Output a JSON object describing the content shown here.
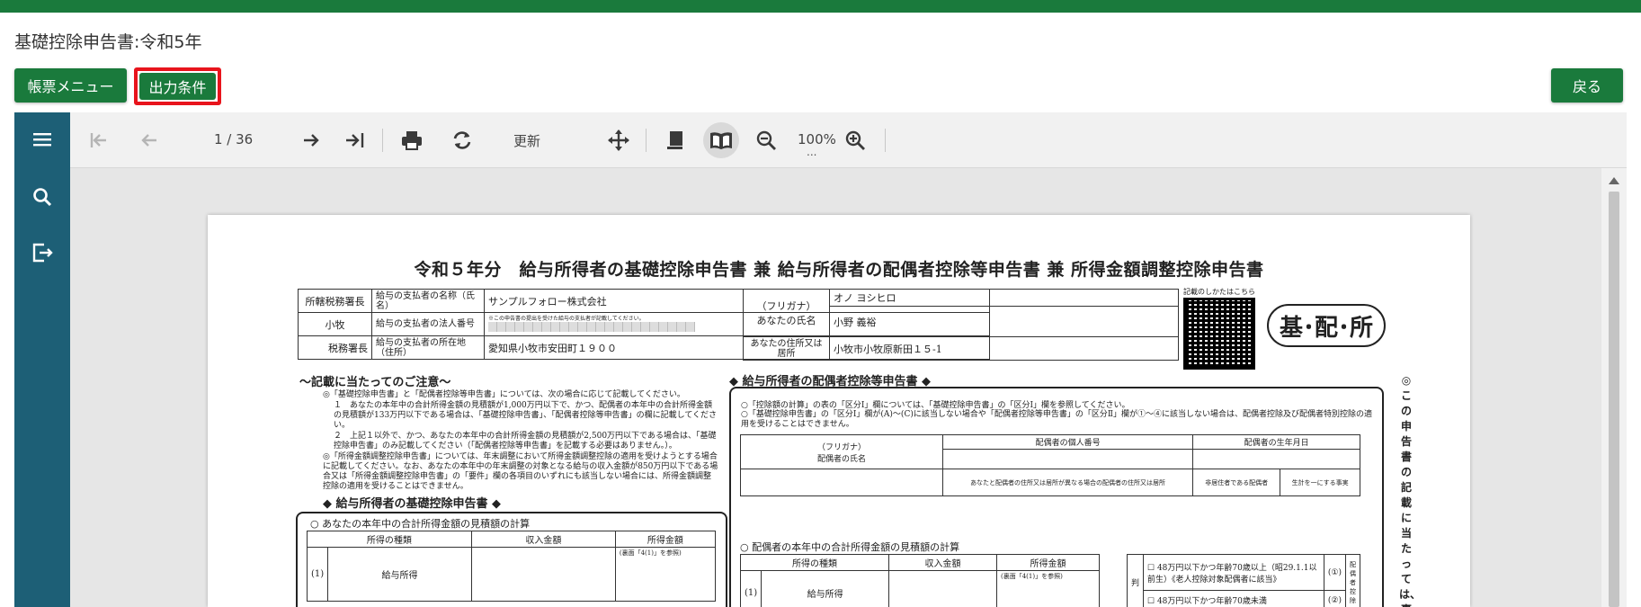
{
  "page": {
    "title": "基礎控除申告書:令和5年"
  },
  "buttons": {
    "menu": "帳票メニュー",
    "condition": "出力条件",
    "back": "戻る"
  },
  "colors": {
    "brand": "#1a7a3c",
    "sidebar": "#1d5f76",
    "highlight": "#e8141c"
  },
  "toolbar": {
    "page_indicator": "1 / 36",
    "refresh": "更新",
    "zoom": "100%",
    "zoom_more": "..."
  },
  "sidebar": {
    "icons": [
      "menu-icon",
      "search-icon",
      "export-icon"
    ]
  },
  "document": {
    "title": "令和５年分　給与所得者の基礎控除申告書 兼 給与所得者の配偶者控除等申告書 兼 所得金額調整控除申告書",
    "tax_office_label": "所轄税務署長",
    "tax_office": "小牧",
    "tax_office_suffix": "税務署長",
    "payer_name_label": "給与の支払者の名称（氏名）",
    "payer_name": "サンプルフォロー株式会社",
    "payer_number_label": "給与の支払者の法人番号",
    "payer_number_note": "※この申告書の提出を受けた給与の支払者が記載してください。",
    "payer_address_label": "給与の支払者の所在地（住所）",
    "payer_address": "愛知県小牧市安田町１９００",
    "furigana_label": "（フリガナ）",
    "name_label": "あなたの氏名",
    "furigana": "オノ ヨシヒロ",
    "name": "小野 義裕",
    "address_label": "あなたの住所又は居所",
    "address": "小牧市小牧原新田１５-1",
    "qr_caption": "記載のしかたはこちら",
    "logo": "基･配･所",
    "notes_title": "～記載に当たってのご注意～",
    "notes": [
      "◎「基礎控除申告書」と「配偶者控除等申告書」については、次の場合に応じて記載してください。",
      "１　あなたの本年中の合計所得金額の見積額が1,000万円以下で、かつ、配偶者の本年中の合計所得金額の見積額が133万円以下である場合は、「基礎控除申告書」、「配偶者控除等申告書」の欄に記載してください。",
      "２　上記１以外で、かつ、あなたの本年中の合計所得金額の見積額が2,500万円以下である場合は、「基礎控除申告書」のみ記載してください（「配偶者控除等申告書」を記載する必要はありません。）。",
      "◎「所得金額調整控除申告書」については、年末調整において所得金額調整控除の適用を受けようとする場合に記載してください。なお、あなたの本年中の年末調整の対象となる給与の収入金額が850万円以下である場合又は「所得金額調整控除申告書」の「要件」欄の各項目のいずれにも該当しない場合には、所得金額調整控除の適用を受けることはできません。"
    ],
    "basic_section": "◆ 給与所得者の基礎控除申告書 ◆",
    "basic_sub": "○ あなたの本年中の合計所得金額の見積額の計算",
    "spouse_section": "◆ 給与所得者の配偶者控除等申告書 ◆",
    "spouse_note1": "○「控除額の計算」の表の「区分Ⅰ」欄については、「基礎控除申告書」の「区分Ⅰ」欄を参照してください。",
    "spouse_note2": "○「基礎控除申告書」の「区分Ⅰ」欄が(A)～(C)に該当しない場合や「配偶者控除等申告書」の「区分Ⅱ」欄が①～④に該当しない場合は、配偶者控除及び配偶者特別控除の適用を受けることはできません。",
    "spouse_furigana": "（フリガナ）",
    "spouse_name_label": "配偶者の氏名",
    "spouse_number_label": "配偶者の個人番号",
    "spouse_birth_label": "配偶者の生年月日",
    "spouse_addr_diff": "あなたと配偶者の住所又は居所が異なる場合の配偶者の住所又は居所",
    "nonresident_label": "非居住者である配偶者",
    "living_label": "生計を一にする事実",
    "spouse_sub": "○ 配偶者の本年中の合計所得金額の見積額の計算",
    "income_cols": [
      "所得の種類",
      "収入金額",
      "所得金額"
    ],
    "income_row": [
      "(1)",
      "給与所得"
    ],
    "income_ref": "(裏面「4(1)」を参照)",
    "judge_label": "判",
    "judge1": "48万円以下かつ年齢70歳以上（昭29.1.1以前生）《老人控除対象配偶者に該当》",
    "judge1_mark": "(①)",
    "judge2": "48万円以下かつ年齢70歳未満",
    "judge2_mark": "(②)",
    "judge_side": "配偶者控除",
    "vertical_note": "◎この申告書の記載に当たっては、裏"
  }
}
